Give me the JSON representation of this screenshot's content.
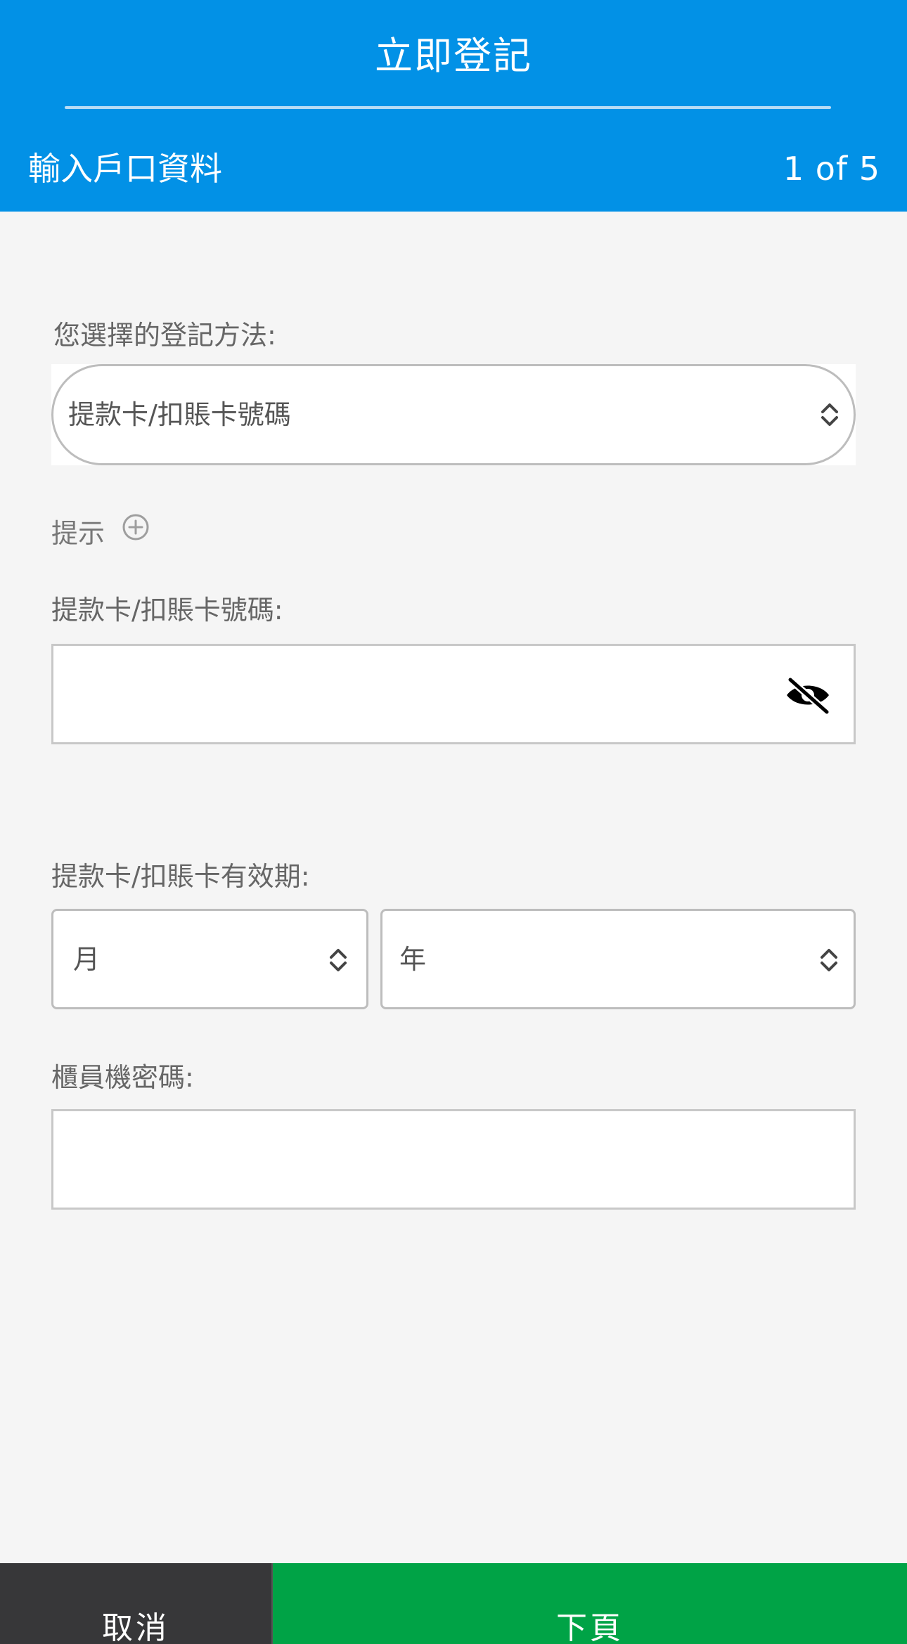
{
  "header": {
    "title": "立即登記",
    "step_title": "輸入戶口資料",
    "step_counter": "1 of 5"
  },
  "form": {
    "method": {
      "label": "您選擇的登記方法:",
      "selected": "提款卡/扣賬卡號碼"
    },
    "tip": {
      "label": "提示"
    },
    "card_number": {
      "label": "提款卡/扣賬卡號碼:",
      "value": ""
    },
    "expiry": {
      "label": "提款卡/扣賬卡有效期:",
      "month_selected": "月",
      "year_selected": "年"
    },
    "atm_pin": {
      "label": "櫃員機密碼:",
      "value": ""
    }
  },
  "footer": {
    "cancel_label": "取消",
    "next_label": "下頁"
  },
  "colors": {
    "header_bg": "#0291e6",
    "cancel_bg": "#373739",
    "next_bg": "#00a346",
    "page_bg": "#f5f5f5"
  },
  "icons": {
    "chevron": "chevron-up-down-icon",
    "tip": "plus-circle-icon",
    "visibility": "eye-off-icon"
  }
}
